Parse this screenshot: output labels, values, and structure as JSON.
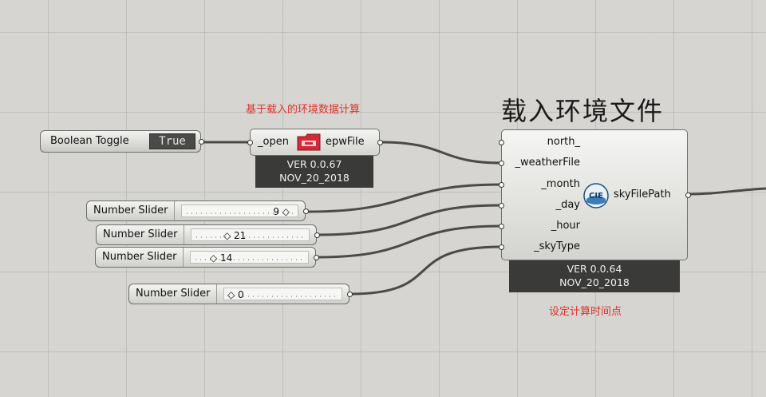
{
  "canvas": {
    "grid_color": "#9a9a95",
    "background": "#d6d5d1"
  },
  "boolean_toggle": {
    "label": "Boolean Toggle",
    "value": "True"
  },
  "sliders": [
    {
      "label": "Number Slider",
      "value": "9"
    },
    {
      "label": "Number Slider",
      "value": "21"
    },
    {
      "label": "Number Slider",
      "value": "14"
    },
    {
      "label": "Number Slider",
      "value": "0"
    }
  ],
  "epw_component": {
    "annotation": "基于载入的环境数据计算",
    "input": "_open",
    "output": "epwFile",
    "icon": "red-folder-icon",
    "version": "VER 0.0.67",
    "date": "NOV_20_2018"
  },
  "sky_component": {
    "title": "载入环境文件",
    "inputs": [
      "north_",
      "_weatherFile",
      "_month",
      "_day",
      "_hour",
      "_skyType"
    ],
    "output": "skyFilePath",
    "icon": "cie-sky-icon",
    "icon_text": "CIE",
    "version": "VER 0.0.64",
    "date": "NOV_20_2018",
    "annotation": "设定计算时间点"
  },
  "colors": {
    "accent_red": "#e0332c",
    "info_bg": "#3a3a38"
  }
}
